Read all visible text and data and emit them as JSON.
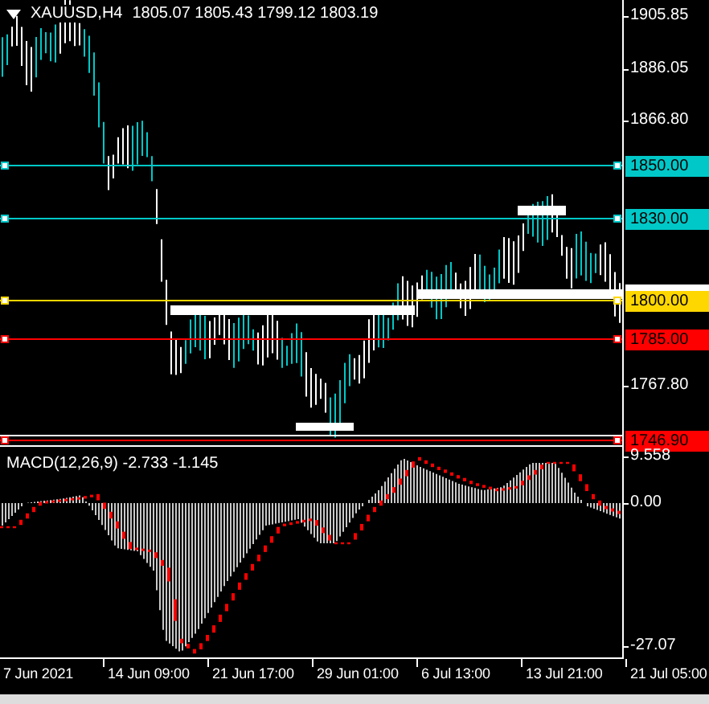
{
  "header": {
    "symbol": "XAUUSD,H4",
    "ohlc": "1805.07 1805.43 1799.12 1803.19"
  },
  "price_axis": {
    "ticks": [
      "1905.85",
      "1886.05",
      "1866.80",
      "1767.80"
    ]
  },
  "price_levels": [
    {
      "label": "1850.00",
      "color": "#00c8c8"
    },
    {
      "label": "1830.00",
      "color": "#00c8c8"
    },
    {
      "label": "1800.00",
      "color": "#ffd700"
    },
    {
      "label": "1785.00",
      "color": "#ff0000"
    },
    {
      "label": "1746.90",
      "color": "#ff0000"
    }
  ],
  "indicator": {
    "label": "MACD(12,26,9) -2.733 -1.145",
    "ticks": [
      "9.558",
      "0.00",
      "-27.07"
    ]
  },
  "time_axis": {
    "labels": [
      "7 Jun 2021",
      "14 Jun 09:00",
      "21 Jun 17:00",
      "29 Jun 01:00",
      "6 Jul 13:00",
      "13 Jul 21:00",
      "21 Jul 05:00"
    ]
  }
}
